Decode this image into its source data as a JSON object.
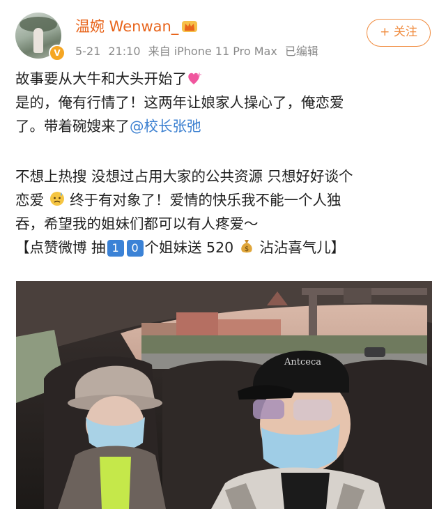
{
  "author": {
    "name": "温婉 Wenwan_",
    "verified_badge": "V",
    "avatar_icon": "avatar-photo",
    "crown_icon": "crown-icon"
  },
  "meta": {
    "date": "5-21",
    "time": "21:10",
    "source": "来自 iPhone 11 Pro Max",
    "edited": "已编辑"
  },
  "follow_button": {
    "label": "+ 关注"
  },
  "post": {
    "line1": "故事要从大牛和大头开始了",
    "line2": "是的，俺有行情了！这两年让娘家人操心了，俺恋爱",
    "line3_prefix": "了。带着碗嫂来了",
    "mention": "@校长张弛",
    "line4": "不想上热搜 没想过占用大家的公共资源 只想好好谈个",
    "line5_prefix": "恋爱",
    "line5_suffix": "终于有对象了！爱情的快乐我不能一个人独",
    "line6": "吞，希望我的姐妹们都可以有人疼爱～",
    "line7_prefix": "【点赞微博 抽",
    "key1": "1",
    "key2": "0",
    "line7_middle": "个姐妹送 520",
    "line7_suffix": "沾沾喜气儿】"
  },
  "colors": {
    "accent": "#e8641b",
    "follow": "#f08a3c",
    "link": "#3a7fd0",
    "meta": "#8a8a8a"
  },
  "photo": {
    "description_icon": "car-selfie-photo"
  }
}
